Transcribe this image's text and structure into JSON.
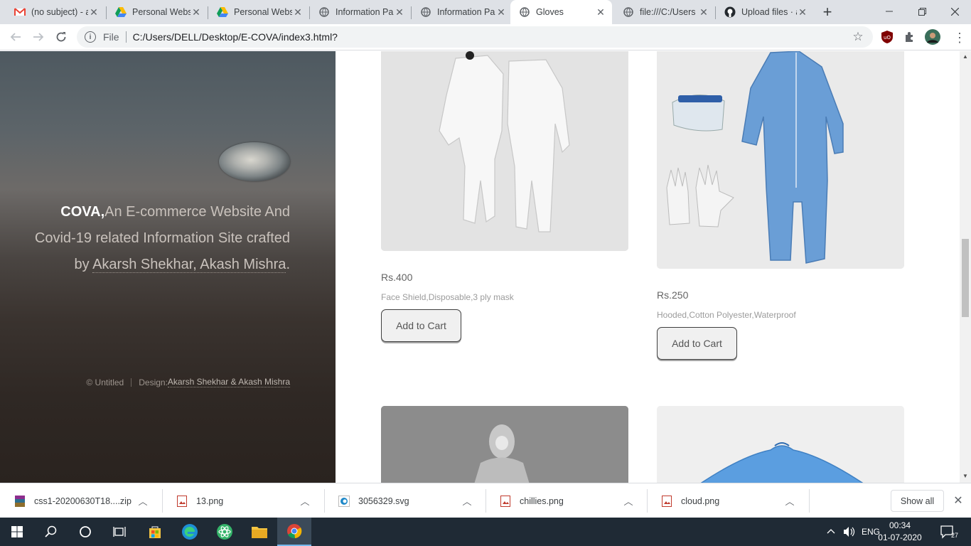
{
  "browser": {
    "tabs": [
      {
        "title": "(no subject) - a",
        "icon": "gmail-icon"
      },
      {
        "title": "Personal Webs",
        "icon": "google-drive-icon"
      },
      {
        "title": "Personal Webs",
        "icon": "google-drive-icon"
      },
      {
        "title": "Information Pa",
        "icon": "globe-icon"
      },
      {
        "title": "Information Pa",
        "icon": "globe-icon"
      },
      {
        "title": "Gloves",
        "icon": "globe-icon",
        "active": true
      },
      {
        "title": "file:///C:/Users",
        "icon": "globe-icon"
      },
      {
        "title": "Upload files · a",
        "icon": "github-icon"
      }
    ],
    "new_tab": "+",
    "address": {
      "scheme_label": "File",
      "url": "C:/Users/DELL/Desktop/E-COVA/index3.html?"
    }
  },
  "sidebar": {
    "brand": "COVA,",
    "tagline_1": "An E-commerce Website And Covid-19 related Information Site crafted by ",
    "authors": "Akarsh Shekhar, Akash Mishra",
    "tagline_end": ".",
    "copyright": "© Untitled",
    "design_label": "Design: ",
    "design_authors": "Akarsh Shekhar & Akash Mishra"
  },
  "products": [
    {
      "price": "Rs.400",
      "desc": "Face Shield,Disposable,3 ply mask",
      "button": "Add to Cart"
    },
    {
      "price": "Rs.250",
      "desc": "Hooded,Cotton Polyester,Waterproof",
      "button": "Add to Cart"
    }
  ],
  "downloads": {
    "items": [
      {
        "name": "css1-20200630T18....zip",
        "icon": "zip-archive-icon"
      },
      {
        "name": "13.png",
        "icon": "image-file-icon"
      },
      {
        "name": "3056329.svg",
        "icon": "edge-file-icon"
      },
      {
        "name": "chillies.png",
        "icon": "image-file-icon"
      },
      {
        "name": "cloud.png",
        "icon": "image-file-icon"
      }
    ],
    "show_all": "Show all"
  },
  "taskbar": {
    "language": "ENG",
    "time": "00:34",
    "date": "01-07-2020",
    "notification_count": "27"
  },
  "colors": {
    "sidebar_top": "#4e5960",
    "sidebar_bottom": "#2a231f",
    "suit_blue": "#6a9ed6",
    "taskbar": "#1f2a35"
  }
}
